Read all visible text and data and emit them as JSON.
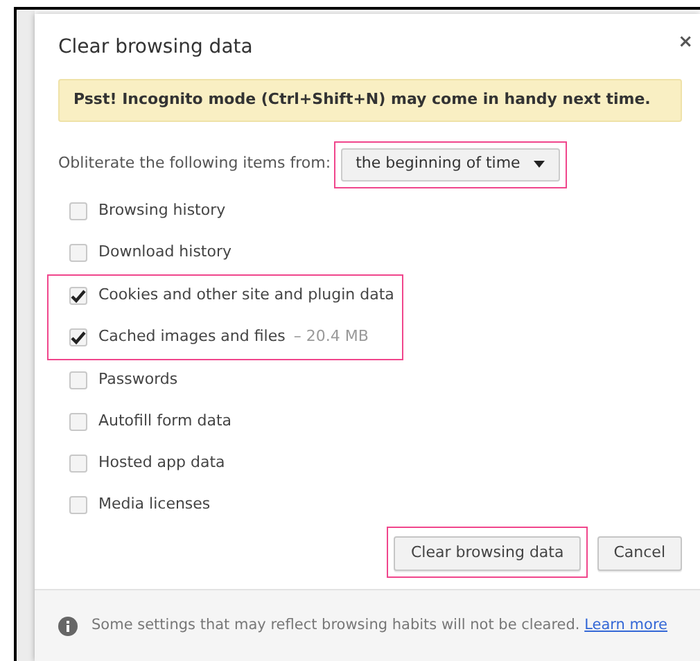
{
  "dialog": {
    "title": "Clear browsing data",
    "close": "×"
  },
  "banner": "Psst! Incognito mode (Ctrl+Shift+N) may come in handy next time.",
  "range": {
    "label": "Obliterate the following items from:",
    "value": "the beginning of time",
    "highlighted": true
  },
  "items": [
    {
      "label": "Browsing history",
      "checked": false,
      "highlighted": false
    },
    {
      "label": "Download history",
      "checked": false,
      "highlighted": false
    },
    {
      "label": "Cookies and other site and plugin data",
      "checked": true,
      "highlighted": true
    },
    {
      "label": "Cached images and files",
      "size": "–  20.4 MB",
      "checked": true,
      "highlighted": true
    },
    {
      "label": "Passwords",
      "checked": false,
      "highlighted": false
    },
    {
      "label": "Autofill form data",
      "checked": false,
      "highlighted": false
    },
    {
      "label": "Hosted app data",
      "checked": false,
      "highlighted": false
    },
    {
      "label": "Media licenses",
      "checked": false,
      "highlighted": false
    }
  ],
  "buttons": [
    {
      "label": "Clear browsing data",
      "highlighted": true
    },
    {
      "label": "Cancel",
      "highlighted": false
    }
  ],
  "footer": {
    "text": "Some settings that may reflect browsing habits will not be cleared.",
    "link": "Learn more"
  }
}
